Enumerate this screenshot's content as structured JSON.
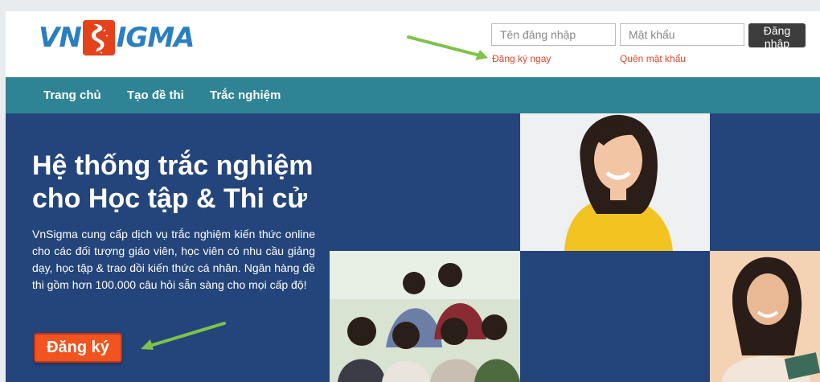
{
  "header": {
    "logo_left": "VN",
    "logo_right": "IGMA",
    "username_placeholder": "Tên đăng nhập",
    "password_placeholder": "Mật khẩu",
    "login_label": "Đăng nhập",
    "register_link": "Đăng ký ngay",
    "forgot_link": "Quên mật khẩu"
  },
  "nav": {
    "items": [
      {
        "label": "Trang chủ"
      },
      {
        "label": "Tạo đề thi"
      },
      {
        "label": "Trắc nghiệm"
      }
    ]
  },
  "hero": {
    "title_line1": "Hệ thống trắc nghiệm",
    "title_line2": "cho Học tập & Thi cử",
    "description": "VnSigma cung cấp dịch vụ trắc nghiệm kiến thức online cho các đối tượng giáo viên, học viên có nhu cầu giảng dạy, học tập & trao dồi kiến thức cá nhân. Ngân hàng đề thi gồm hơn 100.000 câu hỏi sẵn sàng cho mọi cấp độ!",
    "register_label": "Đăng ký"
  },
  "colors": {
    "accent_nav": "#2e8494",
    "hero_bg": "#24457b",
    "register_button": "#f1541f",
    "link_red": "#e0432b",
    "annotation_arrow": "#7fc24a"
  }
}
